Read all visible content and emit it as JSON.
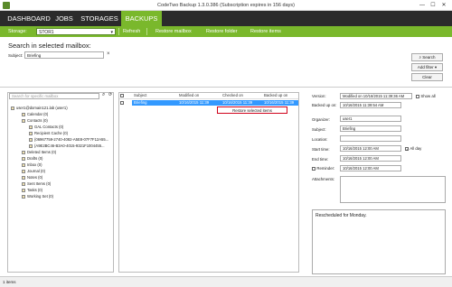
{
  "window": {
    "title": "CodeTwo Backup 1.3.0.386 (Subscription expires in 156 days)",
    "minimize": "—",
    "maximize": "☐",
    "close": "✕"
  },
  "nav": {
    "tabs": [
      {
        "label": "DASHBOARD"
      },
      {
        "label": "JOBS"
      },
      {
        "label": "STORAGES"
      },
      {
        "label": "BACKUPS"
      }
    ]
  },
  "subnav": {
    "storage_label": "Storage:",
    "storage_value": "STOR1",
    "refresh": "Refresh",
    "restore_mailbox": "Restore mailbox",
    "restore_folder": "Restore folder",
    "restore_items": "Restore items"
  },
  "search": {
    "heading": "Search in selected mailbox:",
    "subject_label": "Subject:",
    "subject_value": "Briefing",
    "clear_x": "×",
    "search_button": "Search",
    "add_filter_button": "Add filter",
    "clear_button": "Clear"
  },
  "tree": {
    "search_placeholder": "Search for specific mailbox",
    "items": [
      "user1@domain121.lab (user1)",
      "Calendar (0)",
      "Contacts (0)",
      "GAL Contacts (0)",
      "Recipient Cache (0)",
      "{06967759-2740-4082-A5E8-07F7F12A55...",
      "{A9E2BC46-B3A0-4015-9321F1004455...",
      "Deleted Items (0)",
      "Drafts (0)",
      "Inbox (0)",
      "Journal (0)",
      "Notes (0)",
      "Sent Items (0)",
      "Tasks (0)",
      "Working Set (0)"
    ]
  },
  "list": {
    "columns": [
      "Subject",
      "Modified on",
      "Checked on",
      "Backed up on"
    ],
    "rows": [
      {
        "subject": "Briefing",
        "modified": "10/16/2015 11:39",
        "checked": "10/16/2015 11:39",
        "backed": "10/16/2015 11:39"
      }
    ],
    "context_menu_item": "Restore selected items"
  },
  "details": {
    "version_label": "Version:",
    "version_value": "Modified on 10/16/2015 11:39:36 AM",
    "show_all": "Show all",
    "backed_up_label": "Backed up on:",
    "backed_up_value": "10/16/2015 11:39:54 AM",
    "organizer_label": "Organizer:",
    "organizer_value": "user1",
    "subject_label": "Subject:",
    "subject_value": "Briefing",
    "location_label": "Location:",
    "location_value": "",
    "start_label": "Start time:",
    "start_value": "10/16/2015 12:00 AM",
    "all_day": "All day",
    "end_label": "End time:",
    "end_value": "10/16/2015 12:00 AM",
    "reminder_label": "Reminder:",
    "reminder_value": "10/16/2015 12:00 AM",
    "attachments_label": "Attachments:",
    "notes": "Rescheduled for Monday."
  },
  "status": {
    "text": "1 items"
  },
  "colors": {
    "accent": "#7ab82c",
    "nav_bg": "#2b2b2b",
    "selection": "#3399ff",
    "highlight_border": "#d0021b"
  }
}
